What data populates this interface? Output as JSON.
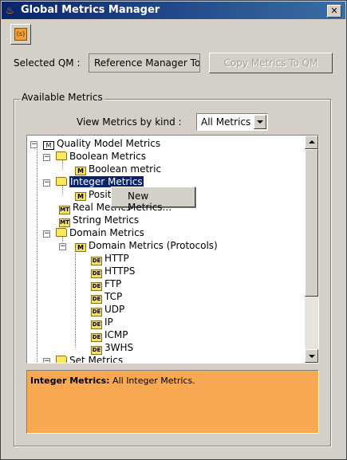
{
  "window": {
    "title": "Global Metrics Manager",
    "close_label": "✕"
  },
  "toolbar": {
    "action_icon": "metrics-icon"
  },
  "selected_qm": {
    "label": "Selected QM :",
    "value": "Reference Manager To",
    "copy_button": "Copy Metrics To QM"
  },
  "available": {
    "group_title": "Available Metrics",
    "view_label": "View Metrics by kind :",
    "kind_selected": "All Metrics"
  },
  "tree": {
    "root": "Quality Model Metrics",
    "boolean": "Boolean Metrics",
    "boolean_child": "Boolean metric",
    "integer": "Integer Metrics",
    "integer_child": "Posit",
    "real": "Real Metrics",
    "string": "String Metrics",
    "domain": "Domain Metrics",
    "protocols": "Domain Metrics (Protocols)",
    "protocol_items": [
      "HTTP",
      "HTTPS",
      "FTP",
      "TCP",
      "UDP",
      "IP",
      "ICMP",
      "3WHS"
    ],
    "set": "Set Metrics"
  },
  "context_menu": {
    "new_metrics": "New Metrics..."
  },
  "description": {
    "title": "Integer Metrics:",
    "text": " All Integer Metrics."
  },
  "colors": {
    "selection": "#0a246a",
    "description_bg": "#f8a850",
    "titlebar": "#0a246a"
  }
}
